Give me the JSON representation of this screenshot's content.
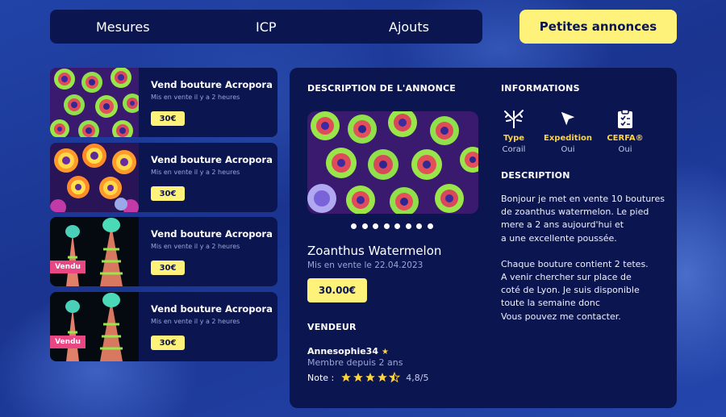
{
  "nav": {
    "tabs": [
      {
        "label": "Mesures"
      },
      {
        "label": "ICP"
      },
      {
        "label": "Ajouts"
      }
    ],
    "active_button": "Petites annonces"
  },
  "listings": [
    {
      "title": "Vend bouture Acropora",
      "subtitle": "Mis en vente il y a 2 heures",
      "price": "30€",
      "badge": ""
    },
    {
      "title": "Vend bouture Acropora",
      "subtitle": "Mis en vente il y a 2 heures",
      "price": "30€",
      "badge": ""
    },
    {
      "title": "Vend bouture Acropora",
      "subtitle": "Mis en vente il y a 2 heures",
      "price": "30€",
      "badge": "Vendu"
    },
    {
      "title": "Vend bouture Acropora",
      "subtitle": "Mis en vente il y a 2 heures",
      "price": "30€",
      "badge": "Vendu"
    }
  ],
  "detail": {
    "section_title": "DESCRIPTION DE L'ANNONCE",
    "product_name": "Zoanthus Watermelon",
    "date": "Mis en vente le 22.04.2023",
    "price": "30.00€",
    "image_count": 8,
    "seller_heading": "VENDEUR",
    "seller_name": "Annesophie34",
    "seller_since": "Membre depuis 2 ans",
    "rating_label": "Note :",
    "rating_value": 4.5,
    "rating_text": "4,8/5"
  },
  "info": {
    "heading": "INFORMATIONS",
    "items": [
      {
        "icon": "coral-icon",
        "label": "Type",
        "value": "Corail"
      },
      {
        "icon": "send-icon",
        "label": "Expedition",
        "value": "Oui"
      },
      {
        "icon": "clipboard-icon",
        "label": "CERFA®",
        "value": "Oui"
      }
    ],
    "description_heading": "DESCRIPTION",
    "description_lines": [
      "Bonjour je met en vente 10 boutures",
      "de zoanthus watermelon. Le pied",
      "mere a 2 ans aujourd'hui et",
      "a une excellente poussée.",
      "",
      "Chaque bouture contient 2 tetes.",
      "A venir chercher sur place de",
      "coté de Lyon. Je suis disponible",
      "toute la semaine donc",
      "Vous pouvez me contacter."
    ]
  },
  "colors": {
    "accent_yellow": "#fff27a",
    "panel_navy": "#0b1550",
    "sold_pink": "#e84783",
    "star_yellow": "#ffd43b"
  }
}
